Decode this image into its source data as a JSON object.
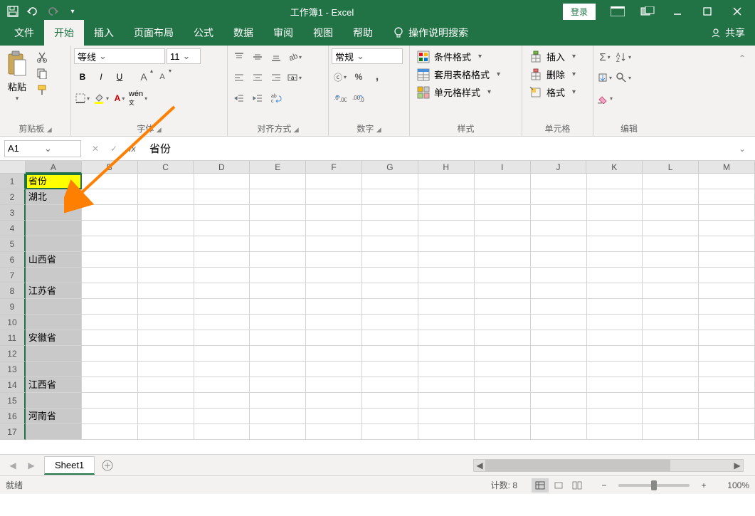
{
  "title": "工作簿1 - Excel",
  "login": "登录",
  "tabs": [
    "文件",
    "开始",
    "插入",
    "页面布局",
    "公式",
    "数据",
    "审阅",
    "视图",
    "帮助"
  ],
  "active_tab": 1,
  "tell_me": "操作说明搜索",
  "share": "共享",
  "ribbon_groups": {
    "clipboard": "剪贴板",
    "font": "字体",
    "align": "对齐方式",
    "number": "数字",
    "styles": "样式",
    "cells": "单元格",
    "editing": "编辑"
  },
  "paste_label": "粘贴",
  "font_name": "等线",
  "font_size": "11",
  "number_format": "常规",
  "style_buttons": {
    "cond": "条件格式",
    "table": "套用表格格式",
    "cell": "单元格样式"
  },
  "cell_buttons": {
    "insert": "插入",
    "delete": "删除",
    "format": "格式"
  },
  "name_box": "A1",
  "formula_value": "省份",
  "columns": [
    "A",
    "B",
    "C",
    "D",
    "E",
    "F",
    "G",
    "H",
    "I",
    "J",
    "K",
    "L",
    "M"
  ],
  "selected_col": 0,
  "rows": 17,
  "cells_colA": [
    "省份",
    "湖北",
    "",
    "",
    "",
    "山西省",
    "",
    "江苏省",
    "",
    "",
    "安徽省",
    "",
    "",
    "江西省",
    "",
    "河南省",
    ""
  ],
  "sheet_name": "Sheet1",
  "status_ready": "就绪",
  "status_count": "计数: 8",
  "zoom": "100%"
}
